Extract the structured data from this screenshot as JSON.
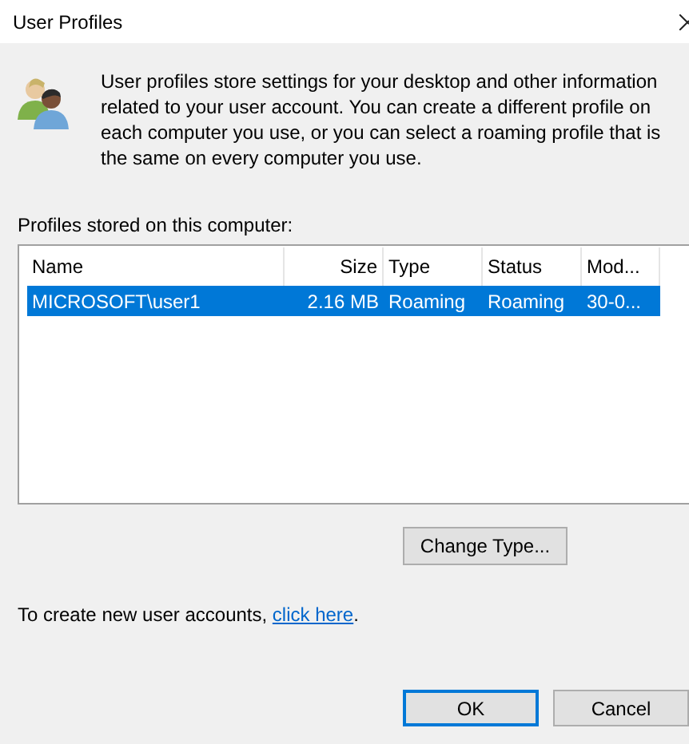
{
  "window": {
    "title": "User Profiles"
  },
  "description": "User profiles store settings for your desktop and other information related to your user account. You can create a different profile on each computer you use, or you can select a roaming profile that is the same on every computer you use.",
  "profiles_label": "Profiles stored on this computer:",
  "table": {
    "columns": [
      "Name",
      "Size",
      "Type",
      "Status",
      "Mod..."
    ],
    "rows": [
      {
        "cells": [
          "MICROSOFT\\user1",
          "2.16 MB",
          "Roaming",
          "Roaming",
          "30-0..."
        ],
        "selected": true
      }
    ]
  },
  "change_type_button": "Change Type...",
  "create_accounts": {
    "text": "To create new user accounts, ",
    "link": "click here",
    "end": "."
  },
  "buttons": [
    {
      "label": "OK",
      "default": true
    },
    {
      "label": "Cancel",
      "default": false
    }
  ]
}
